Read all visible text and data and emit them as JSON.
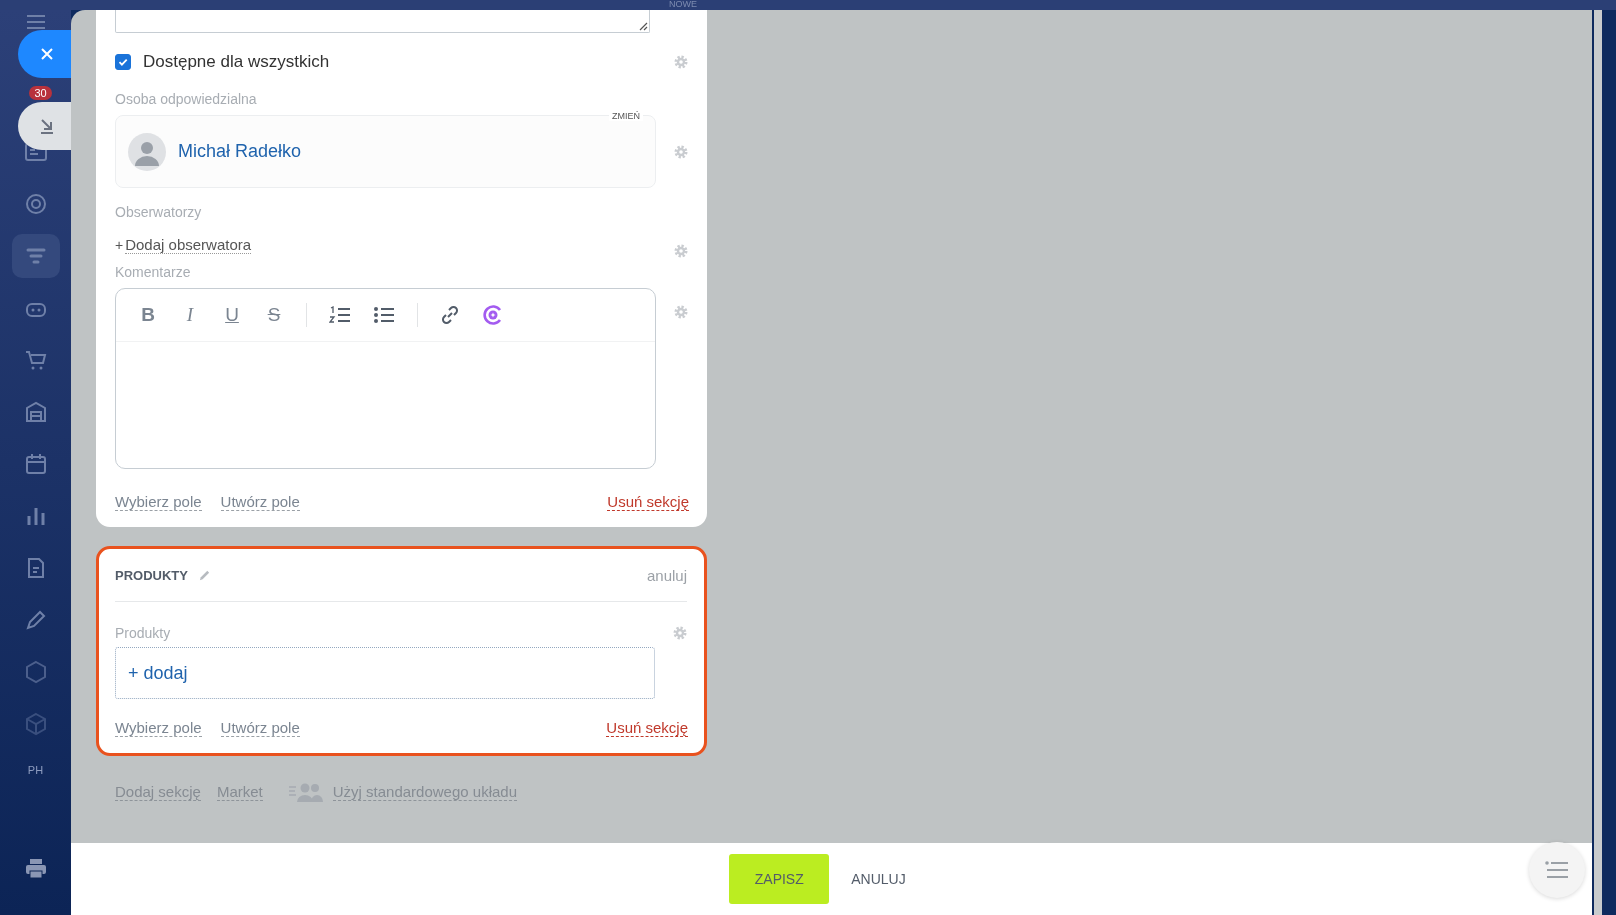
{
  "top_bar": {
    "label": "NOWE"
  },
  "sidebar": {
    "badge": "30",
    "initials": "PH"
  },
  "availability": {
    "label": "Dostępne dla wszystkich",
    "checked": true
  },
  "responsible": {
    "label": "Osoba odpowiedzialna",
    "change": "ZMIEŃ",
    "person": "Michał Radełko"
  },
  "observers": {
    "label": "Obserwatorzy",
    "plus": "+",
    "add": "Dodaj obserwatora"
  },
  "comments": {
    "label": "Komentarze",
    "format_buttons": [
      {
        "kind": "bold",
        "text": "B"
      },
      {
        "kind": "italic",
        "text": "I"
      },
      {
        "kind": "underline",
        "text": "U"
      },
      {
        "kind": "strike",
        "text": "S"
      }
    ]
  },
  "section_links": {
    "choose": "Wybierz pole",
    "create": "Utwórz pole",
    "remove": "Usuń sekcję"
  },
  "products_section": {
    "title": "PRODUKTY",
    "cancel": "anuluj",
    "highlighted": true,
    "field_label": "Produkty",
    "add": "+ dodaj",
    "choose": "Wybierz pole",
    "create": "Utwórz pole",
    "remove": "Usuń sekcję"
  },
  "bottom_links": {
    "add_section": "Dodaj sekcję",
    "market": "Market",
    "standard_layout": "Użyj standardowego układu"
  },
  "footer": {
    "save": "ZAPISZ",
    "cancel": "ANULUJ"
  }
}
